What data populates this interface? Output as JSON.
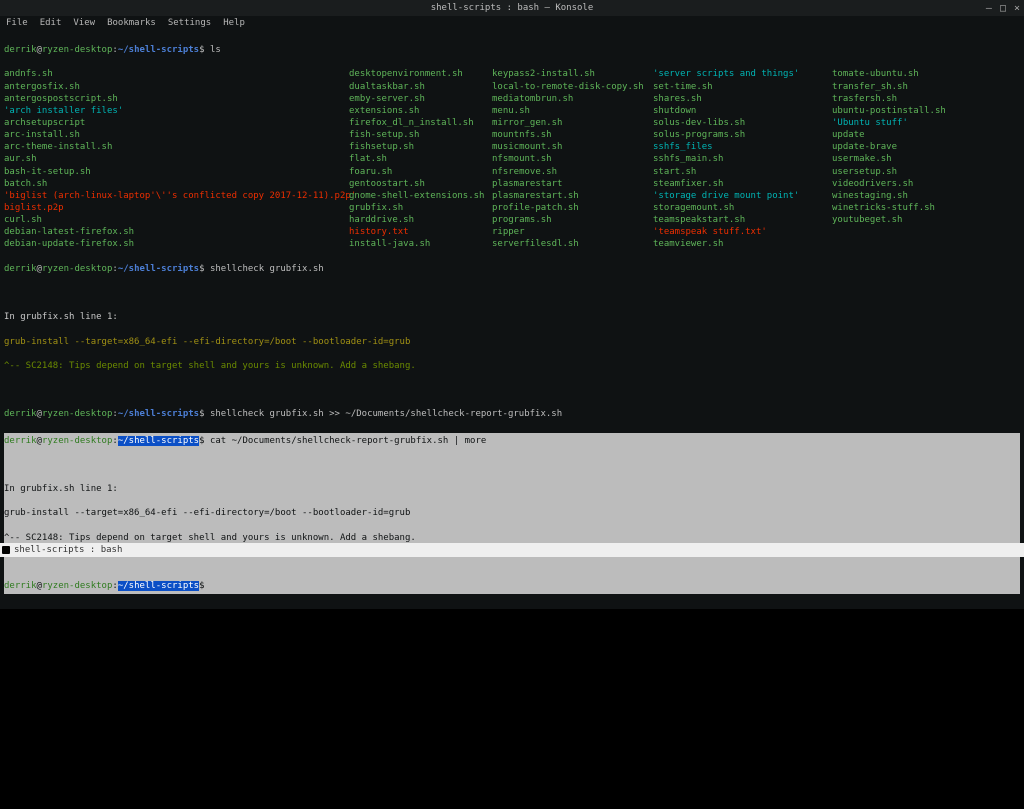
{
  "window": {
    "title": "shell-scripts : bash — Konsole",
    "controls": {
      "min": "–",
      "max": "□",
      "close": "×"
    }
  },
  "menu": [
    "File",
    "Edit",
    "View",
    "Bookmarks",
    "Settings",
    "Help"
  ],
  "prompt": {
    "user": "derrik",
    "host": "ryzen-desktop",
    "path": "~/shell-scripts",
    "dollar": "$"
  },
  "cmds": {
    "ls": "ls",
    "shellcheck1": "shellcheck grubfix.sh",
    "shellcheck2": "shellcheck grubfix.sh >> ~/Documents/shellcheck-report-grubfix.sh",
    "cat": "cat ~/Documents/shellcheck-report-grubfix.sh | more"
  },
  "ls_cols": [
    [
      {
        "t": "andnfs.sh",
        "c": "star"
      },
      {
        "t": "antergosfix.sh",
        "c": "star"
      },
      {
        "t": "antergospostscript.sh",
        "c": "star"
      },
      {
        "t": "'arch installer files'",
        "c": "quote"
      },
      {
        "t": "archsetupscript",
        "c": "star"
      },
      {
        "t": "arc-install.sh",
        "c": "star"
      },
      {
        "t": "arc-theme-install.sh",
        "c": "star"
      },
      {
        "t": "aur.sh",
        "c": "star"
      },
      {
        "t": "bash-it-setup.sh",
        "c": "star"
      },
      {
        "t": "batch.sh",
        "c": "star"
      },
      {
        "t": "'biglist (arch-linux-laptop'\\''s conflicted copy 2017-12-11).p2p'",
        "c": "dir"
      },
      {
        "t": "biglist.p2p",
        "c": "dir"
      },
      {
        "t": "curl.sh",
        "c": "star"
      },
      {
        "t": "debian-latest-firefox.sh",
        "c": "star"
      },
      {
        "t": "debian-update-firefox.sh",
        "c": "star"
      }
    ],
    [
      {
        "t": "desktopenvironment.sh",
        "c": "star"
      },
      {
        "t": "dualtaskbar.sh",
        "c": "star"
      },
      {
        "t": "emby-server.sh",
        "c": "star"
      },
      {
        "t": "extensions.sh",
        "c": "star"
      },
      {
        "t": "firefox_dl_n_install.sh",
        "c": "star"
      },
      {
        "t": "fish-setup.sh",
        "c": "star"
      },
      {
        "t": "fishsetup.sh",
        "c": "star"
      },
      {
        "t": "flat.sh",
        "c": "star"
      },
      {
        "t": "foaru.sh",
        "c": "star"
      },
      {
        "t": "gentoostart.sh",
        "c": "star"
      },
      {
        "t": "gnome-shell-extensions.sh",
        "c": "star"
      },
      {
        "t": "grubfix.sh",
        "c": "star"
      },
      {
        "t": "harddrive.sh",
        "c": "star"
      },
      {
        "t": "history.txt",
        "c": "dir"
      },
      {
        "t": "install-java.sh",
        "c": "star"
      }
    ],
    [
      {
        "t": "keypass2-install.sh",
        "c": "star"
      },
      {
        "t": "local-to-remote-disk-copy.sh",
        "c": "star"
      },
      {
        "t": "mediatombrun.sh",
        "c": "star"
      },
      {
        "t": "menu.sh",
        "c": "star"
      },
      {
        "t": "mirror_gen.sh",
        "c": "star"
      },
      {
        "t": "mountnfs.sh",
        "c": "star"
      },
      {
        "t": "musicmount.sh",
        "c": "star"
      },
      {
        "t": "nfsmount.sh",
        "c": "star"
      },
      {
        "t": "nfsremove.sh",
        "c": "star"
      },
      {
        "t": "plasmarestart",
        "c": "star"
      },
      {
        "t": "plasmarestart.sh",
        "c": "star"
      },
      {
        "t": "profile-patch.sh",
        "c": "star"
      },
      {
        "t": "programs.sh",
        "c": "star"
      },
      {
        "t": "ripper",
        "c": "star"
      },
      {
        "t": "serverfilesdl.sh",
        "c": "star"
      }
    ],
    [
      {
        "t": "'server scripts and things'",
        "c": "quote"
      },
      {
        "t": "set-time.sh",
        "c": "star"
      },
      {
        "t": "shares.sh",
        "c": "star"
      },
      {
        "t": "shutdown",
        "c": "star"
      },
      {
        "t": "solus-dev-libs.sh",
        "c": "star"
      },
      {
        "t": "solus-programs.sh",
        "c": "star"
      },
      {
        "t": "sshfs_files",
        "c": "quote"
      },
      {
        "t": "sshfs_main.sh",
        "c": "star"
      },
      {
        "t": "start.sh",
        "c": "star"
      },
      {
        "t": "steamfixer.sh",
        "c": "star"
      },
      {
        "t": "'storage drive mount point'",
        "c": "quote"
      },
      {
        "t": "storagemount.sh",
        "c": "star"
      },
      {
        "t": "teamspeakstart.sh",
        "c": "star"
      },
      {
        "t": "'teamspeak stuff.txt'",
        "c": "dir"
      },
      {
        "t": "teamviewer.sh",
        "c": "star"
      }
    ],
    [
      {
        "t": "tomate-ubuntu.sh",
        "c": "star"
      },
      {
        "t": "transfer_sh.sh",
        "c": "star"
      },
      {
        "t": "trasfersh.sh",
        "c": "star"
      },
      {
        "t": "ubuntu-postinstall.sh",
        "c": "star"
      },
      {
        "t": "'Ubuntu stuff'",
        "c": "quote"
      },
      {
        "t": "update",
        "c": "star"
      },
      {
        "t": "update-brave",
        "c": "star"
      },
      {
        "t": "usermake.sh",
        "c": "star"
      },
      {
        "t": "usersetup.sh",
        "c": "star"
      },
      {
        "t": "videodrivers.sh",
        "c": "star"
      },
      {
        "t": "winestaging.sh",
        "c": "star"
      },
      {
        "t": "winetricks-stuff.sh",
        "c": "star"
      },
      {
        "t": "youtubeget.sh",
        "c": "star"
      }
    ]
  ],
  "shellcheck_block1": {
    "l1": "In grubfix.sh line 1:",
    "l2": "grub-install --target=x86_64-efi --efi-directory=/boot --bootloader-id=grub",
    "l3": "^-- SC2148: Tips depend on target shell and yours is unknown. Add a shebang."
  },
  "highlight": {
    "l1": "In grubfix.sh line 1:",
    "l2": "grub-install --target=x86_64-efi --efi-directory=/boot --bootloader-id=grub",
    "l3": "^-- SC2148: Tips depend on target shell and yours is unknown. Add a shebang."
  },
  "taskbar": {
    "label": "shell-scripts : bash"
  }
}
